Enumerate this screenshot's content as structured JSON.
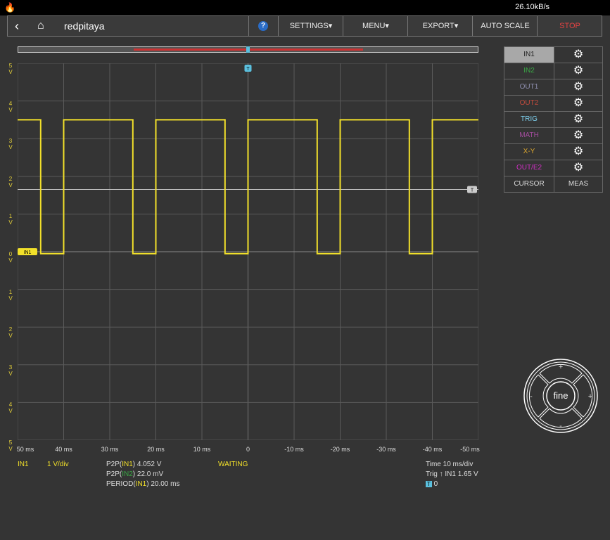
{
  "statusbar": {
    "net_speed": "26.10kB/s"
  },
  "nav": {
    "brand": "redpitaya",
    "help": "?",
    "settings": "SETTINGS",
    "menu": "MENU",
    "export": "EXPORT",
    "autoscale": "AUTO SCALE",
    "stop": "STOP"
  },
  "channels": [
    {
      "name": "IN1",
      "color": "#333333"
    },
    {
      "name": "IN2",
      "color": "#3aa845"
    },
    {
      "name": "OUT1",
      "color": "#8f8fb0"
    },
    {
      "name": "OUT2",
      "color": "#c24b3d"
    },
    {
      "name": "TRIG",
      "color": "#7fd3f2"
    },
    {
      "name": "MATH",
      "color": "#a24d9c"
    },
    {
      "name": "X-Y",
      "color": "#d8a52f"
    },
    {
      "name": "OUT/E2",
      "color": "#d02fc4"
    }
  ],
  "side_bottom": {
    "cursor": "CURSOR",
    "meas": "MEAS"
  },
  "plot": {
    "y_ticks": [
      "5",
      "4",
      "3",
      "2",
      "1",
      "0",
      "1",
      "2",
      "3",
      "4",
      "5"
    ],
    "y_unit": "V",
    "x_ticks": [
      "50 ms",
      "40 ms",
      "30 ms",
      "20 ms",
      "10 ms",
      "0",
      "-10 ms",
      "-20 ms",
      "-30 ms",
      "-40 ms",
      "-50 ms"
    ],
    "trigger_marker": "T",
    "trigger_level_marker": "T",
    "ch_marker": "IN1"
  },
  "info": {
    "ch": "IN1",
    "scale": "1 V/div",
    "p2p_in1_label": "P2P(",
    "p2p_in1_ch": "IN1",
    "p2p_in1_val": ") 4.052 V",
    "p2p_in2_label": "P2P(",
    "p2p_in2_ch": "IN2",
    "p2p_in2_val": ") 22.0 mV",
    "period_label": "PERIOD(",
    "period_ch": "IN1",
    "period_val": ") 20.00 ms",
    "state": "WAITING",
    "time": "Time 10 ms/div",
    "trig": "Trig ↑ IN1 1.65 V",
    "trig_pos": "0",
    "trig_pos_icon": "T"
  },
  "fine": {
    "label": "fine",
    "plus": "+",
    "minus": "-"
  },
  "colors": {
    "signal": "#f2e02a",
    "grid": "#5a5a5a",
    "trigger": "#5bc0de",
    "stop": "#e34242"
  },
  "chart_data": {
    "type": "line",
    "title": "",
    "xlabel": "",
    "ylabel": "",
    "xlim": [
      50,
      -50
    ],
    "ylim": [
      -5,
      5
    ],
    "grid": true,
    "series": [
      {
        "name": "IN1",
        "x": [
          50,
          45,
          45,
          40,
          40,
          25,
          25,
          20,
          20,
          5,
          5,
          0,
          0,
          -15,
          -15,
          -20,
          -20,
          -35,
          -35,
          -40,
          -40,
          -50
        ],
        "values": [
          3.5,
          3.5,
          -0.05,
          -0.05,
          3.5,
          3.5,
          -0.05,
          -0.05,
          3.5,
          3.5,
          -0.05,
          -0.05,
          3.5,
          3.5,
          -0.05,
          -0.05,
          3.5,
          3.5,
          -0.05,
          -0.05,
          3.5,
          3.5
        ]
      }
    ],
    "trigger_level": 1.65
  }
}
